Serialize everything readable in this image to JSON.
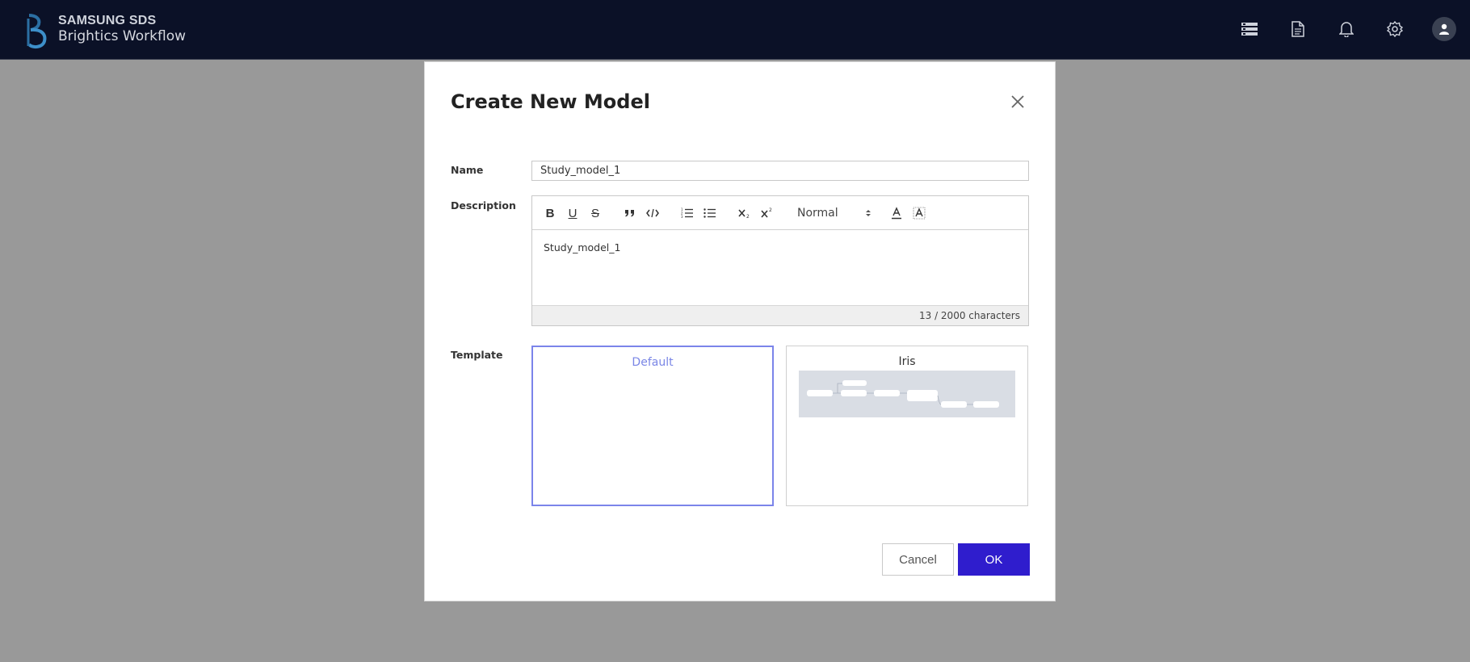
{
  "header": {
    "company": "SAMSUNG SDS",
    "product": "Brightics Workflow",
    "icons": [
      "server-icon",
      "document-icon",
      "bell-icon",
      "gear-icon",
      "user-avatar-icon"
    ]
  },
  "dialog": {
    "title": "Create New Model",
    "name_label": "Name",
    "name_value": "Study_model_1",
    "description_label": "Description",
    "editor": {
      "toolbar": {
        "bold": "B",
        "underline": "U",
        "strike": "S",
        "blockquote": "quote-icon",
        "code": "code-icon",
        "ordered_list": "ordered-list-icon",
        "bullet_list": "bullet-list-icon",
        "subscript": "subscript-icon",
        "superscript": "superscript-icon",
        "format_value": "Normal",
        "font_color": "font-color-icon",
        "background_color": "background-color-icon"
      },
      "content": "Study_model_1",
      "char_count": "13 / 2000 characters"
    },
    "template_label": "Template",
    "templates": [
      {
        "title": "Default",
        "selected": true
      },
      {
        "title": "Iris",
        "selected": false
      }
    ],
    "buttons": {
      "cancel": "Cancel",
      "ok": "OK"
    }
  },
  "colors": {
    "topbar": "#0b1127",
    "overlay": "#999999",
    "primary_button": "#2f1dcd",
    "selected_border": "#7b84ea"
  }
}
